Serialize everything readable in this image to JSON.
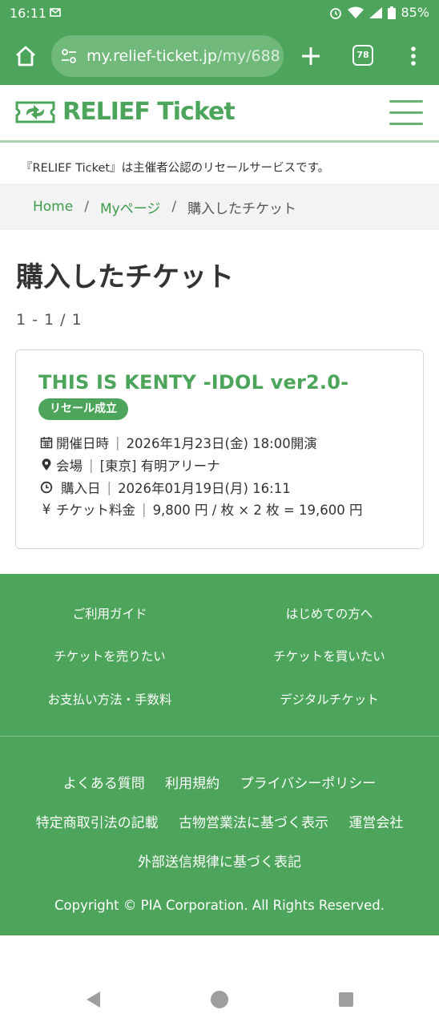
{
  "status_bar": {
    "time": "16:11",
    "battery": "85%"
  },
  "browser": {
    "url_main": "my.relief-ticket.jp",
    "url_path": "/my/688",
    "tab_count": "78"
  },
  "site": {
    "logo_text": "RELIEF Ticket",
    "notice": "『RELIEF Ticket』は主催者公認のリセールサービスです。"
  },
  "breadcrumb": {
    "home": "Home",
    "sep": "/",
    "mypage": "Myページ",
    "current": "購入したチケット"
  },
  "page": {
    "title": "購入したチケット",
    "pager": "1 - 1 / 1"
  },
  "ticket": {
    "event_name": "THIS IS KENTY -IDOL ver2.0-",
    "status_badge": "リセール成立",
    "date_label": "開催日時",
    "date_value": "2026年1月23日(金) 18:00開演",
    "venue_label": "会場",
    "venue_value": "[東京] 有明アリーナ",
    "purchase_label": "購入日",
    "purchase_value": "2026年01月19日(月) 16:11",
    "price_icon": "¥",
    "price_label": "チケット料金",
    "price_value": "9,800 円 / 枚 × 2 枚 = 19,600 円"
  },
  "footer": {
    "grid": [
      "ご利用ガイド",
      "はじめての方へ",
      "チケットを売りたい",
      "チケットを買いたい",
      "お支払い方法・手数料",
      "デジタルチケット"
    ],
    "links_row1": [
      "よくある質問",
      "利用規約",
      "プライバシーポリシー"
    ],
    "links_row2": [
      "特定商取引法の記載",
      "古物営業法に基づく表示",
      "運営会社"
    ],
    "links_row3": [
      "外部送信規律に基づく表記"
    ],
    "copyright": "Copyright © PIA Corporation. All Rights Reserved."
  },
  "colors": {
    "brand_green": "#4ca55a",
    "link_green": "#3e9b4b"
  }
}
